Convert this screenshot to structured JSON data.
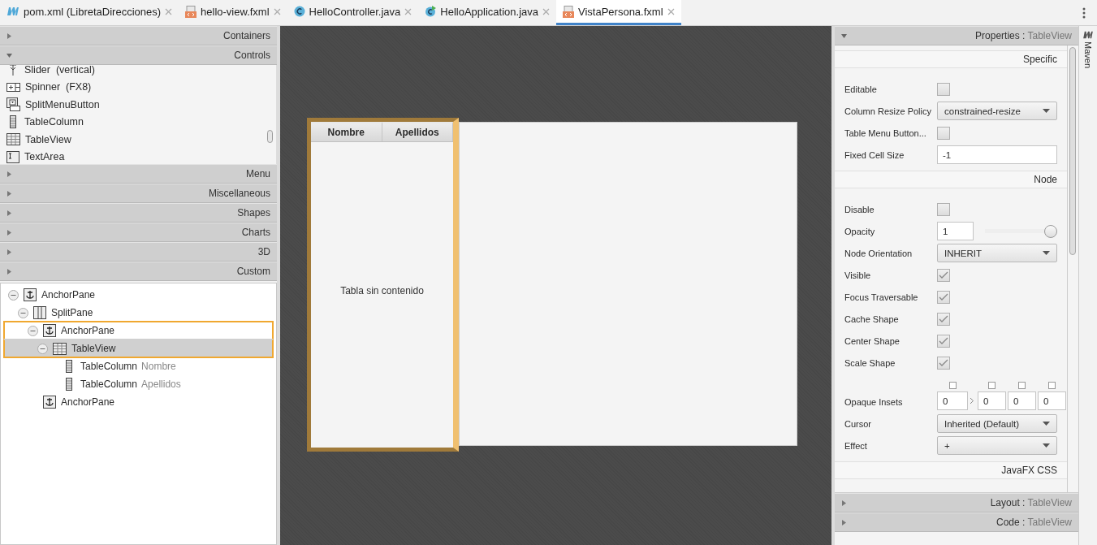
{
  "tabs": [
    {
      "label": "pom.xml (LibretaDirecciones)",
      "kind": "maven",
      "selected": false
    },
    {
      "label": "hello-view.fxml",
      "kind": "fxml",
      "selected": false
    },
    {
      "label": "HelloController.java",
      "kind": "class",
      "selected": false
    },
    {
      "label": "HelloApplication.java",
      "kind": "app",
      "selected": false
    },
    {
      "label": "VistaPersona.fxml",
      "kind": "fxml",
      "selected": true
    }
  ],
  "library": {
    "sections": [
      {
        "title": "Containers",
        "expanded": false
      },
      {
        "title": "Controls",
        "expanded": true,
        "items": [
          {
            "label": "Slider  (vertical)",
            "kind": "slider"
          },
          {
            "label": "Spinner  (FX8)",
            "kind": "spinner"
          },
          {
            "label": "SplitMenuButton",
            "kind": "splitmenu"
          },
          {
            "label": "TableColumn",
            "kind": "column"
          },
          {
            "label": "TableView",
            "kind": "table"
          },
          {
            "label": "TextArea",
            "kind": "textarea"
          }
        ]
      },
      {
        "title": "Menu",
        "expanded": false
      },
      {
        "title": "Miscellaneous",
        "expanded": false
      },
      {
        "title": "Shapes",
        "expanded": false
      },
      {
        "title": "Charts",
        "expanded": false
      },
      {
        "title": "3D",
        "expanded": false
      },
      {
        "title": "Custom",
        "expanded": false
      }
    ]
  },
  "hierarchy": [
    {
      "label": "AnchorPane",
      "kind": "anchor",
      "expanded": true,
      "selected": false,
      "outlined": false,
      "children": [
        {
          "label": "SplitPane",
          "kind": "split",
          "expanded": true,
          "selected": false,
          "outlined": false,
          "children": [
            {
              "label": "AnchorPane",
              "kind": "anchor",
              "expanded": true,
              "selected": false,
              "outlined": true,
              "children": [
                {
                  "label": "TableView",
                  "kind": "table",
                  "expanded": true,
                  "selected": true,
                  "outlined": true,
                  "children": [
                    {
                      "label": "TableColumn",
                      "detail": "Nombre",
                      "kind": "column",
                      "selected": false,
                      "outlined": false
                    },
                    {
                      "label": "TableColumn",
                      "detail": "Apellidos",
                      "kind": "column",
                      "selected": false,
                      "outlined": false
                    }
                  ]
                }
              ]
            },
            {
              "label": "AnchorPane",
              "kind": "anchor",
              "selected": false,
              "outlined": false
            }
          ]
        }
      ]
    }
  ],
  "canvas": {
    "table": {
      "columns": [
        "Nombre",
        "Apellidos"
      ],
      "placeholder": "Tabla sin contenido"
    }
  },
  "inspector": {
    "title": "Properties :",
    "target": "TableView",
    "expanded": true,
    "sections": [
      {
        "title": "Specific",
        "rows": [
          {
            "kind": "checkbox",
            "label": "Editable",
            "checked": false
          },
          {
            "kind": "select",
            "label": "Column Resize Policy",
            "value": "constrained-resize"
          },
          {
            "kind": "checkbox",
            "label": "Table Menu Button...",
            "checked": false
          },
          {
            "kind": "text",
            "label": "Fixed Cell Size",
            "value": "-1"
          }
        ]
      },
      {
        "title": "Node",
        "rows": [
          {
            "kind": "checkbox",
            "label": "Disable",
            "checked": false
          },
          {
            "kind": "slider",
            "label": "Opacity",
            "value": "1",
            "level": 1
          },
          {
            "kind": "select",
            "label": "Node Orientation",
            "value": "INHERIT"
          },
          {
            "kind": "checkbox",
            "label": "Visible",
            "checked": true
          },
          {
            "kind": "checkbox",
            "label": "Focus Traversable",
            "checked": true
          },
          {
            "kind": "checkbox",
            "label": "Cache Shape",
            "checked": true
          },
          {
            "kind": "checkbox",
            "label": "Center Shape",
            "checked": true
          },
          {
            "kind": "checkbox",
            "label": "Scale Shape",
            "checked": true
          },
          {
            "kind": "insets",
            "label": "Opaque Insets",
            "fields": [
              {
                "value": "0",
                "checked": false
              },
              {
                "value": "0",
                "checked": false
              },
              {
                "value": "0",
                "checked": false
              },
              {
                "value": "0",
                "checked": false
              }
            ]
          },
          {
            "kind": "select",
            "label": "Cursor",
            "value": "Inherited (Default)"
          },
          {
            "kind": "select",
            "label": "Effect",
            "value": "+"
          }
        ]
      },
      {
        "title": "JavaFX CSS"
      }
    ]
  },
  "panels": [
    {
      "title": "Layout :",
      "target": "TableView",
      "expanded": false
    },
    {
      "title": "Code :",
      "target": "TableView",
      "expanded": false
    }
  ],
  "side_strip": {
    "label": "Maven"
  }
}
